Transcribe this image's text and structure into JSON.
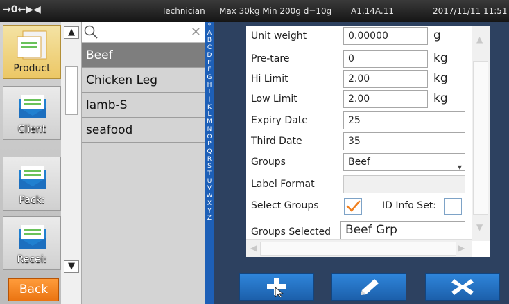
{
  "status_bar": {
    "indicators": "→0←▶◀",
    "user_role": "Technician",
    "capacity": "Max 30kg Min 200g d=10g",
    "version": "A1.14A.11",
    "datetime": "2017/11/11 11:51"
  },
  "nav": {
    "items": [
      {
        "label": "Product",
        "active": true
      },
      {
        "label": "Client"
      },
      {
        "label": "Pack:"
      },
      {
        "label": "Recei:"
      }
    ],
    "back_label": "Back"
  },
  "list": {
    "search_placeholder": "",
    "items": [
      {
        "label": "Beef",
        "selected": true
      },
      {
        "label": "Chicken Leg"
      },
      {
        "label": "lamb-S"
      },
      {
        "label": "seafood"
      }
    ]
  },
  "alphabet": [
    "*",
    "A",
    "B",
    "C",
    "D",
    "E",
    "F",
    "G",
    "H",
    "I",
    "J",
    "K",
    "L",
    "M",
    "N",
    "O",
    "P",
    "Q",
    "R",
    "S",
    "T",
    "U",
    "V",
    "W",
    "X",
    "Y",
    "Z"
  ],
  "form": {
    "unit_weight": {
      "label": "Unit weight",
      "value": "0.00000",
      "unit": "g"
    },
    "pre_tare": {
      "label": "Pre-tare",
      "value": "0",
      "unit": "kg"
    },
    "hi_limit": {
      "label": "Hi Limit",
      "value": "2.00",
      "unit": "kg"
    },
    "low_limit": {
      "label": "Low Limit",
      "value": "2.00",
      "unit": "kg"
    },
    "expiry_date": {
      "label": "Expiry Date",
      "value": "25"
    },
    "third_date": {
      "label": "Third Date",
      "value": "35"
    },
    "groups": {
      "label": "Groups",
      "value": "Beef"
    },
    "label_format": {
      "label": "Label Format",
      "value": ""
    },
    "select_groups": {
      "label": "Select Groups",
      "checked": true
    },
    "id_info_set": {
      "label": "ID Info Set:",
      "checked": false
    },
    "groups_selected": {
      "label": "Groups Selected",
      "value": "Beef Grp"
    }
  },
  "actions": {
    "add": "plus-icon",
    "edit": "pencil-icon",
    "delete": "close-icon"
  },
  "colors": {
    "accent_orange": "#f08020",
    "action_blue": "#2470c4",
    "alpha_blue": "#1d5fb7",
    "selected_row": "#7e7e7e"
  }
}
